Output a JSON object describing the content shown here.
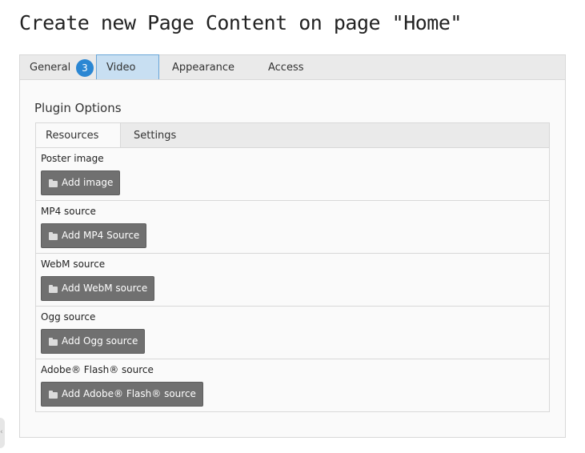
{
  "page": {
    "title": "Create new Page Content on page \"Home\""
  },
  "main_tabs": {
    "general": "General",
    "error_count": "3",
    "video": "Video",
    "appearance": "Appearance",
    "access": "Access",
    "active": "Video"
  },
  "plugin": {
    "section_title": "Plugin Options",
    "inner_tabs": {
      "resources": "Resources",
      "settings": "Settings",
      "active": "Resources"
    },
    "fields": [
      {
        "label": "Poster image",
        "button": "Add image"
      },
      {
        "label": "MP4 source",
        "button": "Add MP4 Source"
      },
      {
        "label": "WebM source",
        "button": "Add WebM source"
      },
      {
        "label": "Ogg source",
        "button": "Add Ogg source"
      },
      {
        "label": "Adobe® Flash® source",
        "button": "Add Adobe® Flash® source"
      }
    ]
  },
  "icons": {
    "button_icon": "folder-icon",
    "side_handle_icon": "chevron-left-icon"
  },
  "colors": {
    "active_tab_bg": "#c8dff2",
    "active_tab_border": "#6aa6d8",
    "badge": "#2b87d3",
    "button_bg": "#707070"
  }
}
